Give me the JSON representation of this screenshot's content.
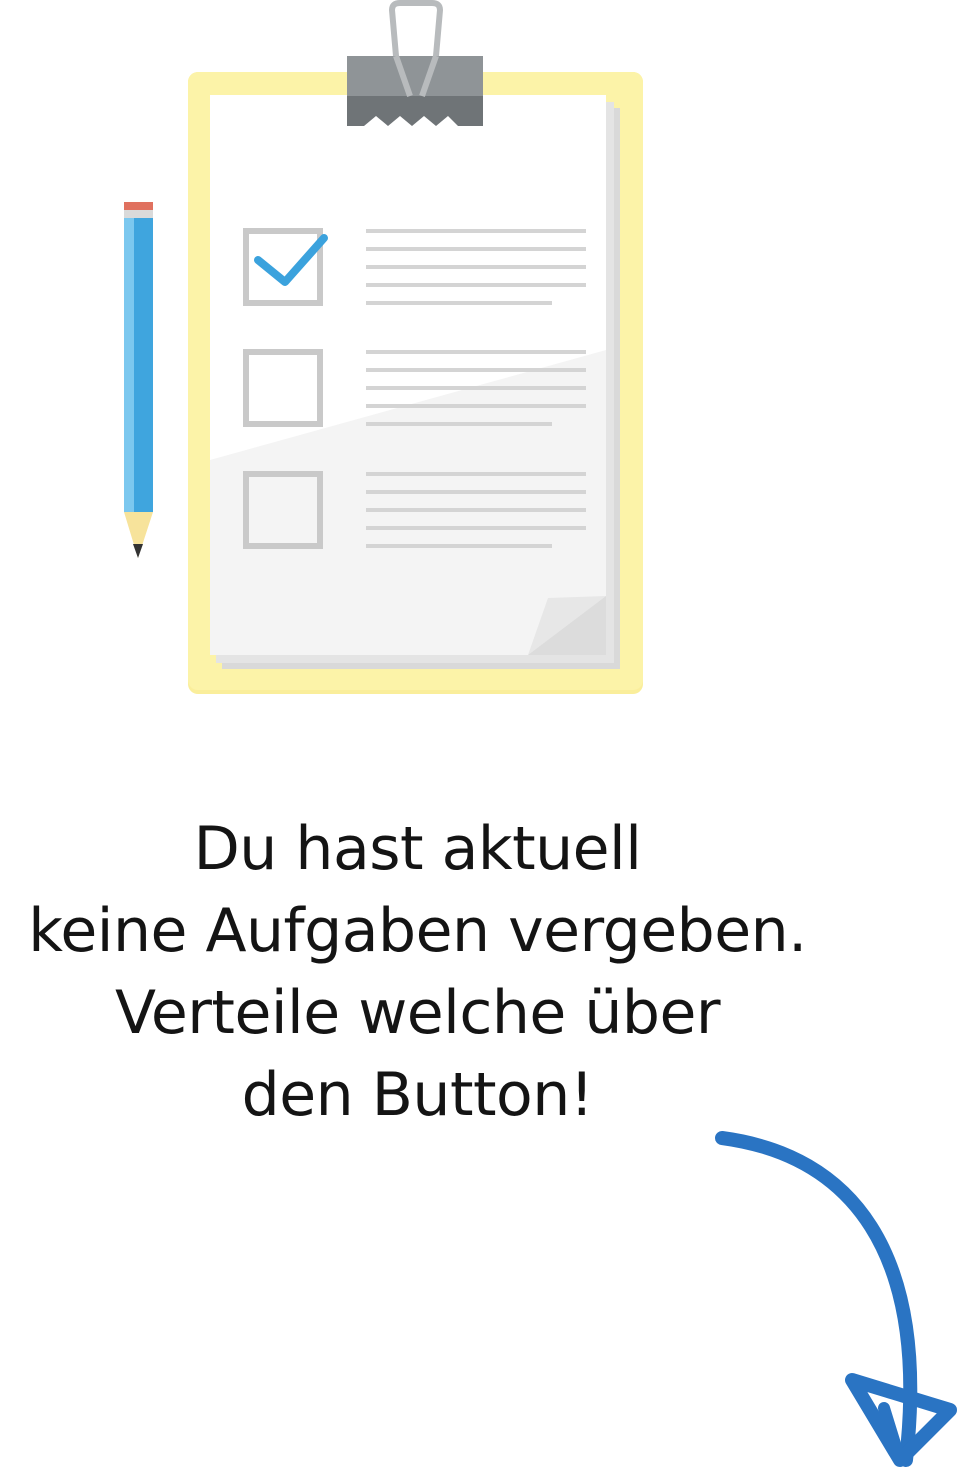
{
  "empty_state": {
    "illustration": "clipboard-checklist-with-pencil",
    "message_lines": [
      "Du hast aktuell",
      "keine Aufgaben vergeben.",
      "Verteile welche über",
      "den Button!"
    ],
    "pointer": "curved-arrow-down-right-icon"
  },
  "colors": {
    "clipboard_board": "#FAEE9B",
    "clipboard_clip": "#8F9497",
    "paper": "#F5F5F5",
    "checkbox_border": "#C9C9C9",
    "checkmark": "#3BA2DD",
    "pencil_body": "#3FA5DE",
    "pencil_eraser": "#E0715F",
    "arrow": "#2A74C3",
    "text": "#141414"
  }
}
